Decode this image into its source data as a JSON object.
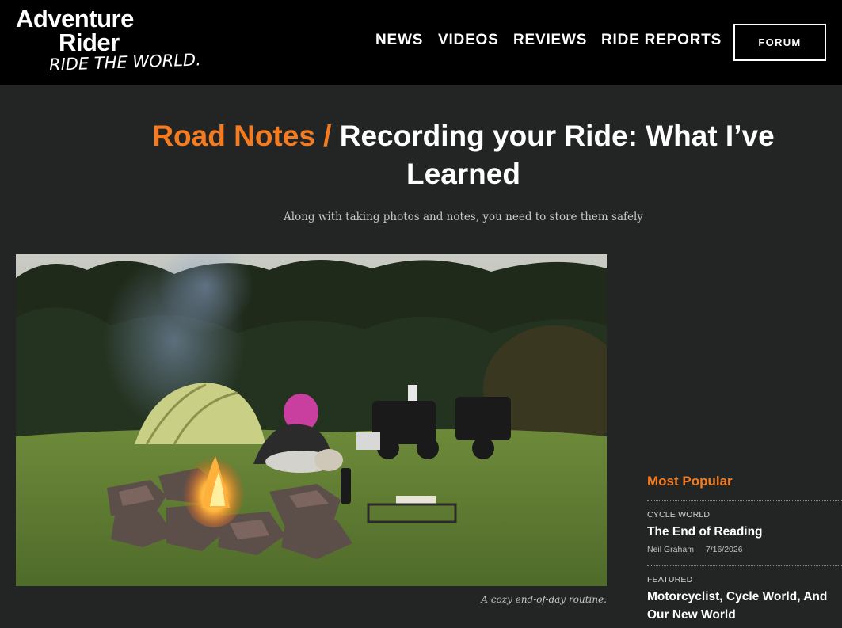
{
  "header": {
    "logo": {
      "line1": "Adventure",
      "line2": "Rider",
      "tagline": "RIDE THE WORLD."
    },
    "nav": [
      {
        "label": "NEWS"
      },
      {
        "label": "VIDEOS"
      },
      {
        "label": "REVIEWS"
      },
      {
        "label": "RIDE REPORTS"
      }
    ],
    "forum_label": "FORUM"
  },
  "article": {
    "category": "Road Notes /",
    "title": "Recording your Ride: What I’ve Learned",
    "subtitle": "Along with taking photos and notes, you need to store them safely",
    "image_caption": "A cozy end-of-day routine."
  },
  "sidebar": {
    "heading": "Most Popular",
    "items": [
      {
        "source": "CYCLE WORLD",
        "title": "The End of Reading",
        "author": "Neil Graham",
        "date": "7/16/2026"
      },
      {
        "source": "FEATURED",
        "title": "Motorcyclist, Cycle World, And Our New World",
        "author": "",
        "date": ""
      }
    ]
  },
  "colors": {
    "accent": "#f47b20",
    "background": "#232525",
    "header_bg": "#000000"
  }
}
